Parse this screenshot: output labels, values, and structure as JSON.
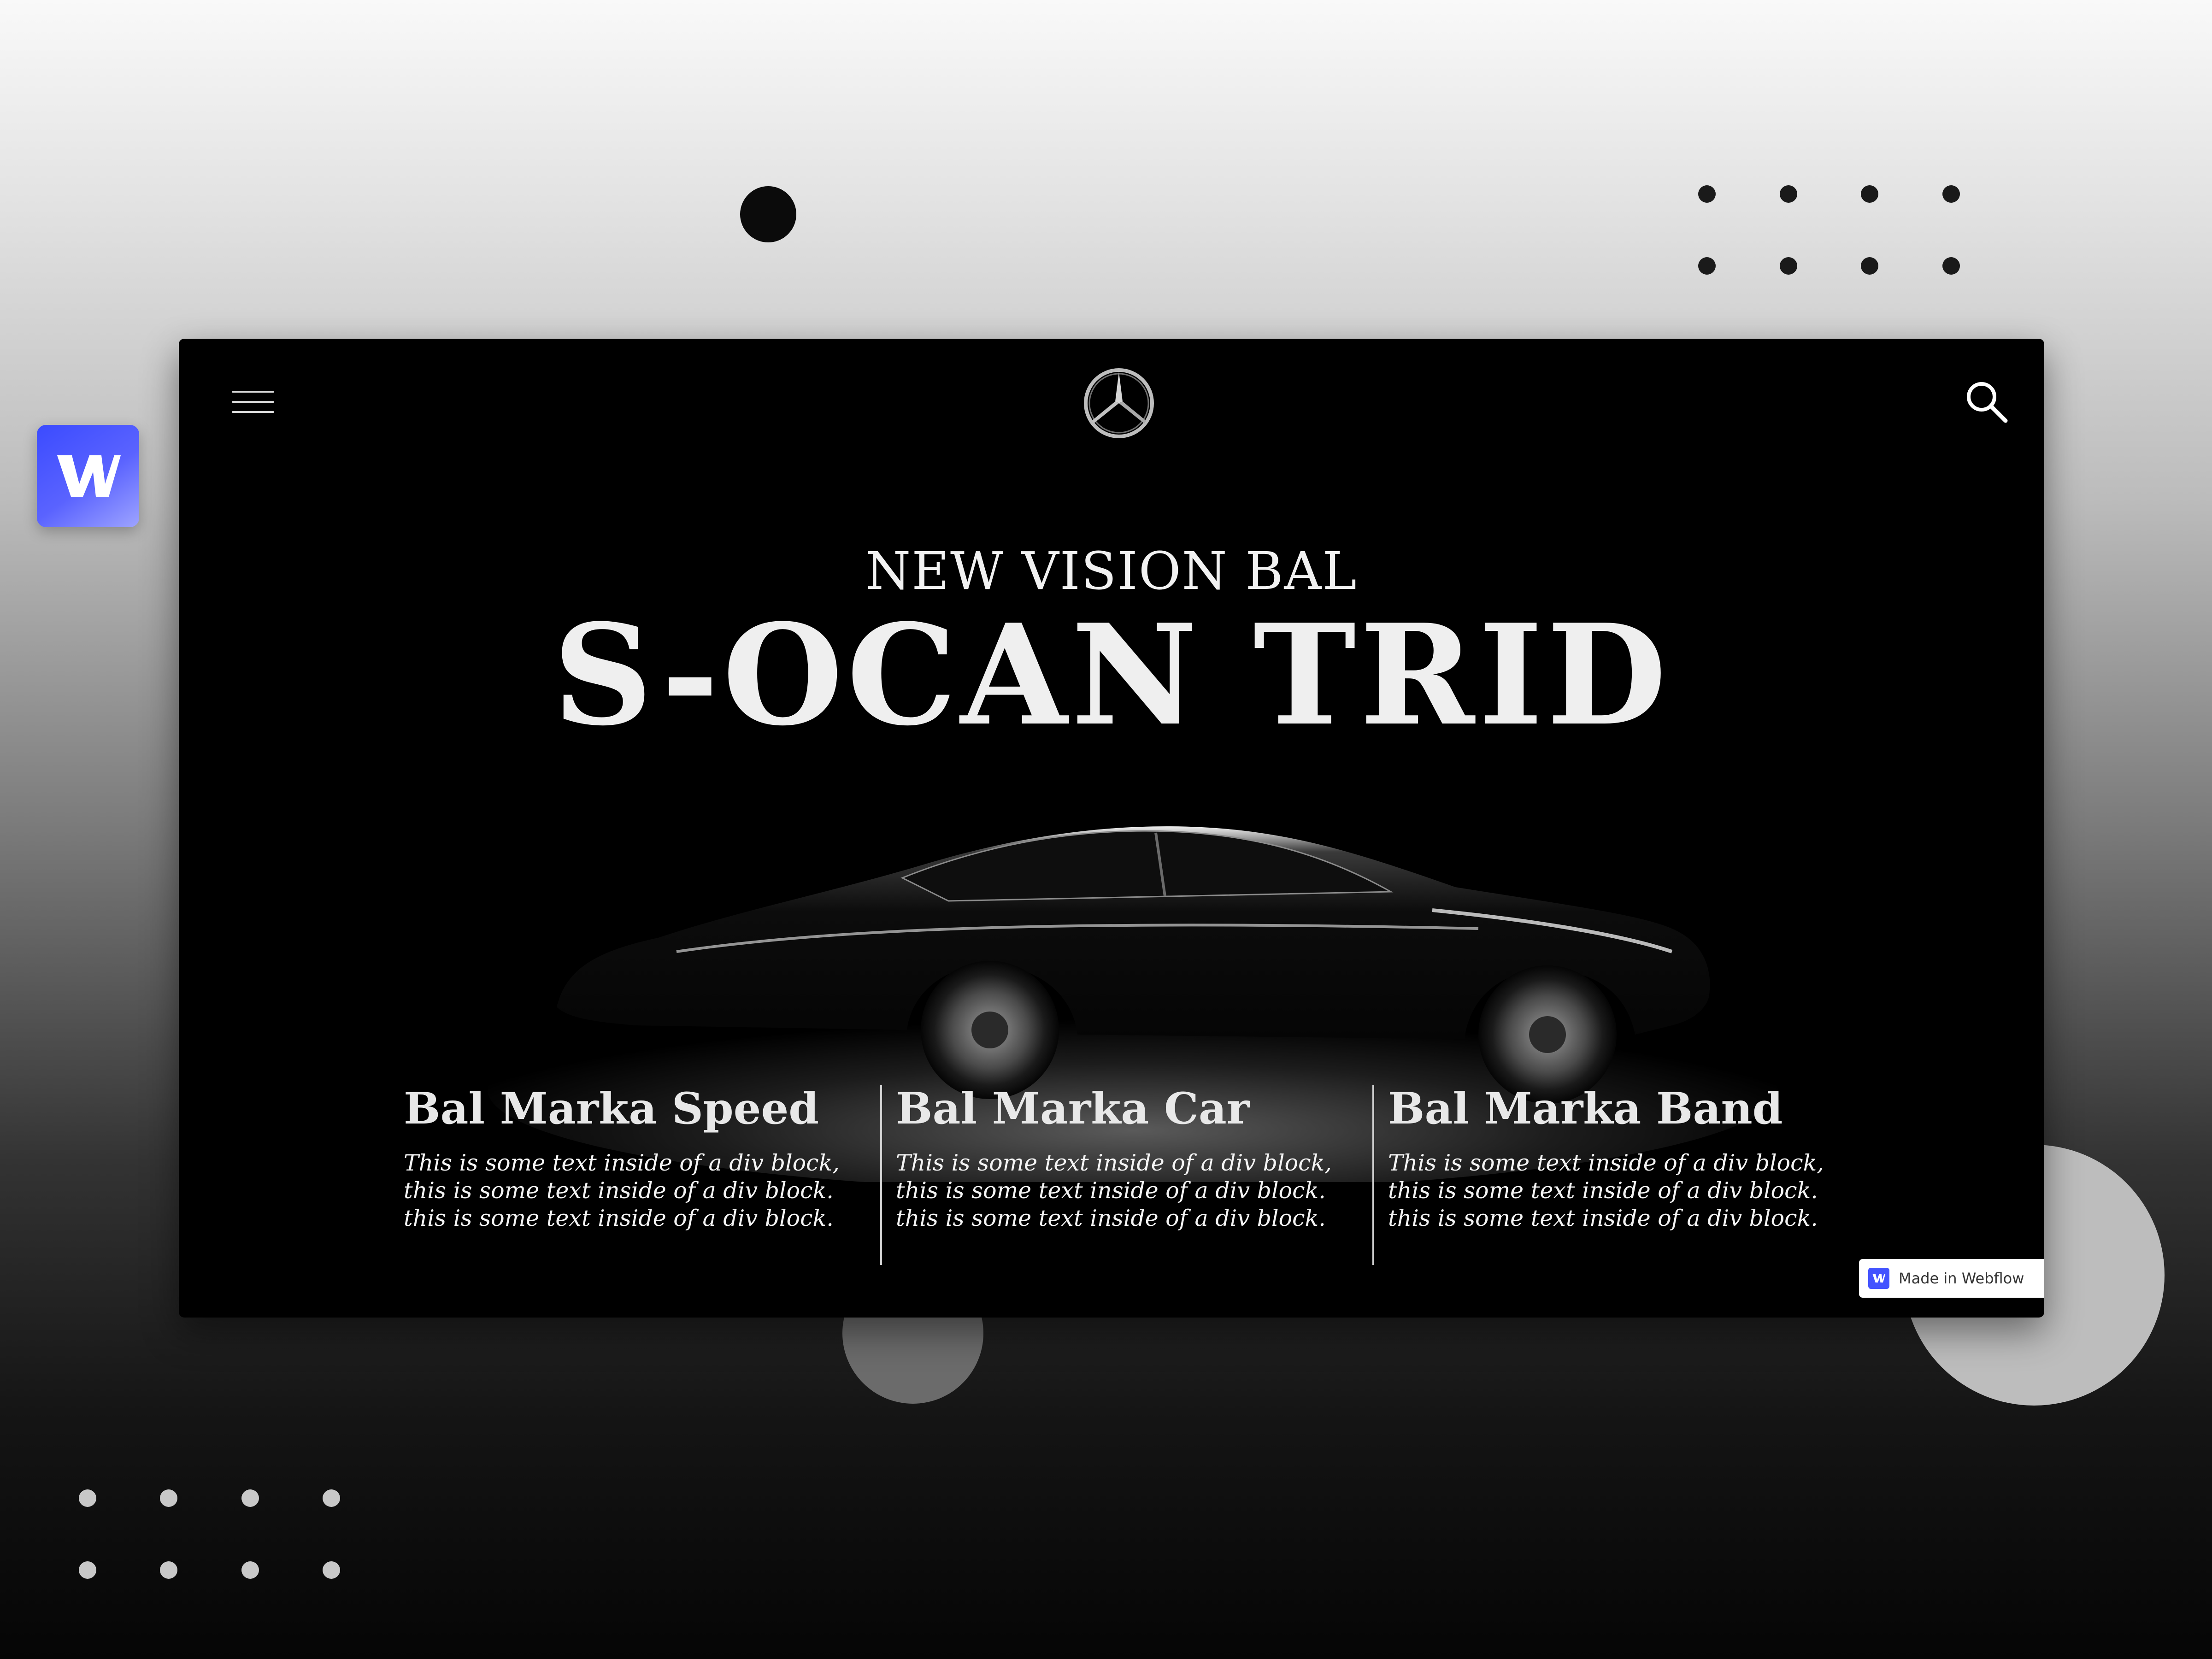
{
  "header": {
    "menu_icon": "hamburger-icon",
    "logo_icon": "three-pointed-star-logo",
    "search_icon": "search-icon"
  },
  "hero": {
    "subtitle": "NEW VISION BAL",
    "headline": "S-OCAN TRID"
  },
  "features": [
    {
      "title": "Bal Marka Speed",
      "text": "This is some text inside of a div block, this is some text inside of a div block. this is some text inside of a div block."
    },
    {
      "title": "Bal Marka Car",
      "text": "This is some text inside of a div block, this is some text inside of a div block. this is some text inside of a div block."
    },
    {
      "title": "Bal Marka Band",
      "text": "This is some text inside of a div block, this is some text inside of a div block. this is some text inside of a div block."
    }
  ],
  "badge": {
    "label": "Made in Webflow",
    "icon": "webflow-w-icon"
  },
  "colors": {
    "frame_bg": "#000000",
    "webflow_blue": "#4353ff",
    "text_light": "#efefef"
  }
}
